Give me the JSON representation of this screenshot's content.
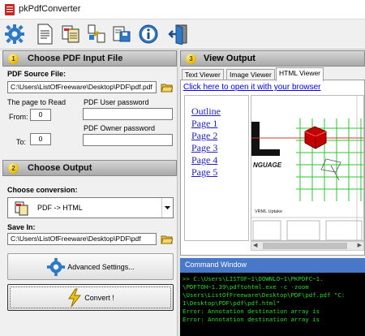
{
  "app": {
    "title": "pkPdfConverter"
  },
  "toolbar": {
    "buttons": [
      {
        "name": "settings-gear-icon"
      },
      {
        "name": "document-icon"
      },
      {
        "name": "pdf-to-text-icon"
      },
      {
        "name": "split-document-icon"
      },
      {
        "name": "save-document-icon"
      },
      {
        "name": "info-icon"
      },
      {
        "name": "exit-door-icon"
      }
    ]
  },
  "input_section": {
    "number": "1",
    "title": "Choose PDF Input File",
    "source_label": "PDF Source File:",
    "source_value": "C:\\Users\\ListOfFreeware\\Desktop\\PDF\\pdf.pdf",
    "page_to_read_label": "The page to Read",
    "from_label": "From:",
    "from_value": "0",
    "to_label": "To:",
    "to_value": "0",
    "user_password_label": "PDF User password",
    "user_password_value": "",
    "owner_password_label": "PDF Owner  password",
    "owner_password_value": ""
  },
  "output_section": {
    "number": "2",
    "title": "Choose Output",
    "conversion_label": "Choose conversion:",
    "conversion_value": "PDF -> HTML",
    "save_in_label": "Save In:",
    "save_in_value": "C:\\Users\\ListOfFreeware\\Desktop\\PDF\\pdf",
    "advanced_button": "Advanced Settings...",
    "convert_button": "Convert !"
  },
  "view_section": {
    "number": "3",
    "title": "View Output",
    "tabs": [
      "Text Viewer",
      "Image Viewer",
      "HTML Viewer"
    ],
    "active_tab": "HTML Viewer",
    "open_link": "Click here to open it with your browser",
    "outline": [
      "Outline",
      "Page 1",
      "Page 2",
      "Page 3",
      "Page 4",
      "Page 5"
    ],
    "preview_text": {
      "brand": "NGUAGE",
      "caption": "VRML Uptake"
    }
  },
  "command_window": {
    "title": "Command Window",
    "lines": [
      ">> C:\\Users\\LISTOF~1\\DOWNLO~1\\PKPDFC~1.",
      "\\PDFTOH~1.39\\pdftohtml.exe  -c  -zoom",
      "\\Users\\ListOfFreeware\\Desktop\\PDF\\pdf.pdf \"C:",
      "1\\Desktop\\PDF\\pdf\\pdf.html\"",
      "Error: Annotation destination array is",
      "Error: Annotation destination array is"
    ]
  },
  "colors": {
    "section_number": "#e6b800",
    "cmd_text": "#2bd52b",
    "cmd_header": "#4a78c8",
    "link": "#0000ee"
  }
}
